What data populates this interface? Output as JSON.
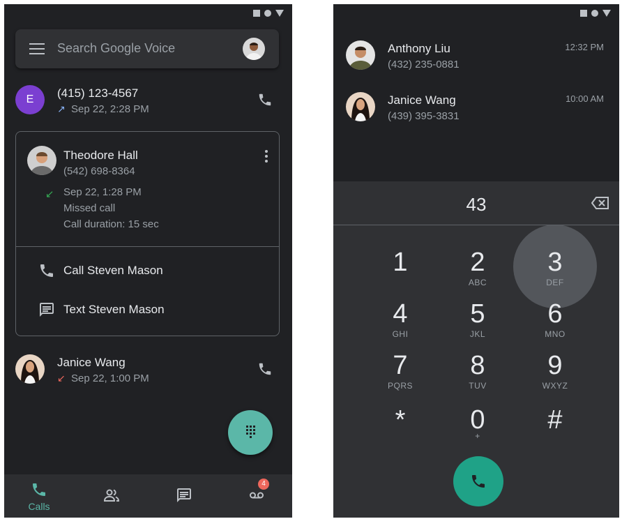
{
  "left": {
    "search_placeholder": "Search Google Voice",
    "calls": [
      {
        "avatar_letter": "E",
        "name": "(415) 123-4567",
        "detail": "Sep 22, 2:28 PM",
        "direction": "outgoing"
      },
      {
        "name": "Janice Wang",
        "detail": "Sep 22, 1:00 PM",
        "direction": "missed"
      }
    ],
    "card": {
      "name": "Theodore Hall",
      "number": "(542) 698-8364",
      "time": "Sep 22, 1:28 PM",
      "status": "Missed call",
      "duration": "Call duration: 15 sec",
      "action_call": "Call Steven Mason",
      "action_text": "Text Steven Mason"
    },
    "nav": {
      "calls_label": "Calls",
      "voicemail_badge": "4"
    }
  },
  "right": {
    "recents": [
      {
        "name": "Anthony Liu",
        "number": "(432) 235-0881",
        "time": "12:32 PM"
      },
      {
        "name": "Janice Wang",
        "number": "(439) 395-3831",
        "time": "10:00 AM"
      }
    ],
    "dial_entry": "43",
    "keys": [
      {
        "digit": "1",
        "letters": ""
      },
      {
        "digit": "2",
        "letters": "ABC"
      },
      {
        "digit": "3",
        "letters": "DEF"
      },
      {
        "digit": "4",
        "letters": "GHI"
      },
      {
        "digit": "5",
        "letters": "JKL"
      },
      {
        "digit": "6",
        "letters": "MNO"
      },
      {
        "digit": "7",
        "letters": "PQRS"
      },
      {
        "digit": "8",
        "letters": "TUV"
      },
      {
        "digit": "9",
        "letters": "WXYZ"
      },
      {
        "digit": "*",
        "letters": ""
      },
      {
        "digit": "0",
        "letters": "+"
      },
      {
        "digit": "#",
        "letters": ""
      }
    ]
  },
  "colors": {
    "background": "#202124",
    "accent": "#5bb7a8",
    "call_button": "#1fa287",
    "missed": "#ee675c",
    "outgoing": "#8ab4f8",
    "incoming_missed": "#34a853"
  }
}
